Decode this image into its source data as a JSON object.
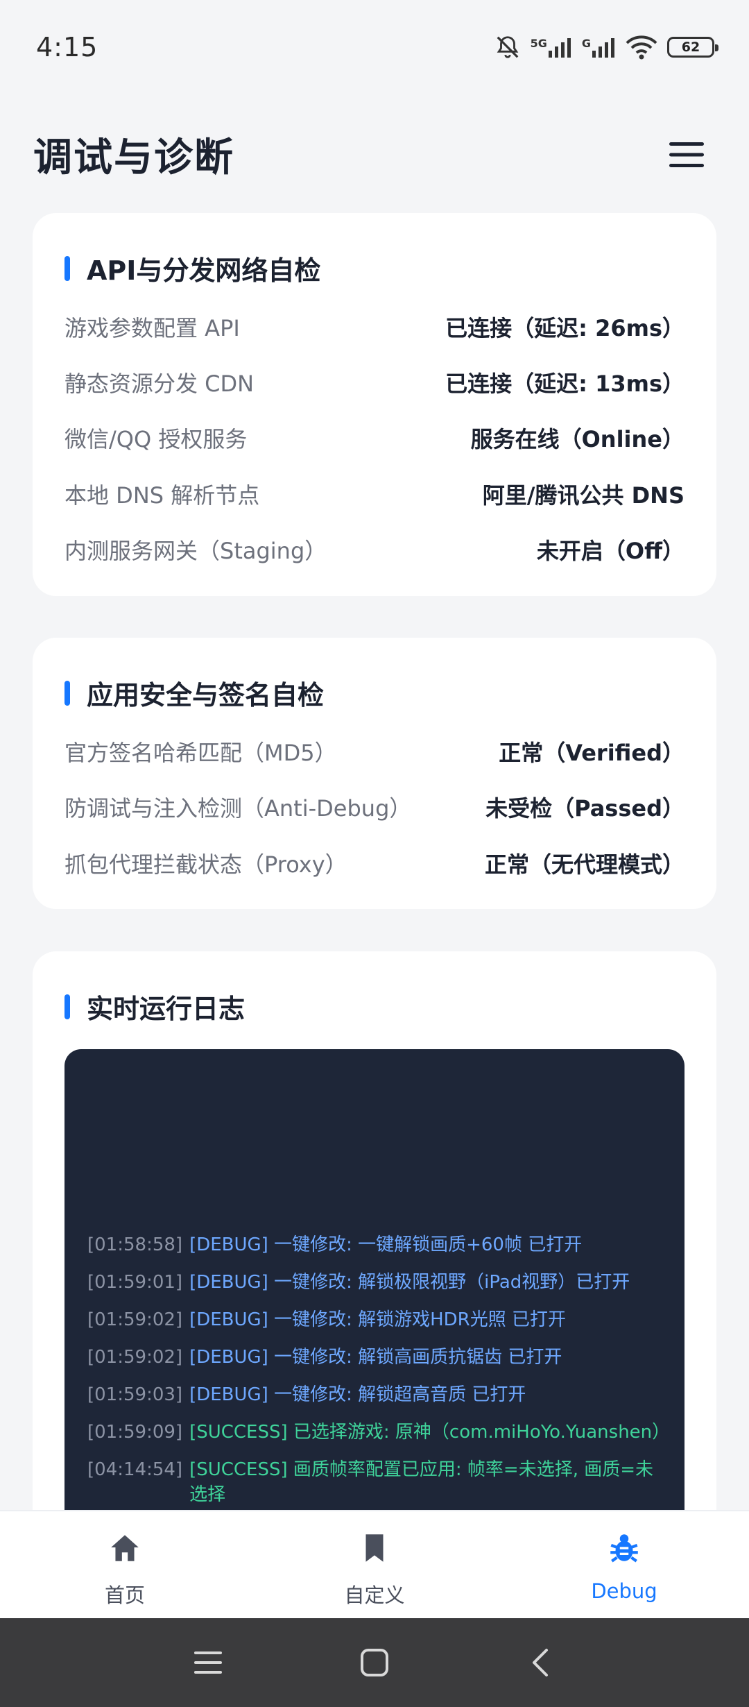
{
  "status_bar": {
    "time": "4:15",
    "network_1": "5G",
    "network_2": "G",
    "battery": "62"
  },
  "header": {
    "title": "调试与诊断",
    "menu_icon": "hamburger-menu-icon"
  },
  "network_card": {
    "title": "API与分发网络自检",
    "rows": [
      {
        "key": "游戏参数配置 API",
        "value": "已连接（延迟: 26ms）"
      },
      {
        "key": "静态资源分发 CDN",
        "value": "已连接（延迟: 13ms）"
      },
      {
        "key": "微信/QQ 授权服务",
        "value": "服务在线（Online）"
      },
      {
        "key": "本地 DNS 解析节点",
        "value": "阿里/腾讯公共 DNS"
      },
      {
        "key": "内测服务网关（Staging）",
        "value": "未开启（Off）"
      }
    ]
  },
  "security_card": {
    "title": "应用安全与签名自检",
    "rows": [
      {
        "key": "官方签名哈希匹配（MD5）",
        "value": "正常（Verified）"
      },
      {
        "key": "防调试与注入检测（Anti-Debug）",
        "value": "未受检（Passed）"
      },
      {
        "key": "抓包代理拦截状态（Proxy）",
        "value": "正常（无代理模式）"
      }
    ]
  },
  "log_card": {
    "title": "实时运行日志",
    "lines": [
      {
        "ts": "[01:58:58]",
        "msg": "[DEBUG] 一键修改: 一键解锁画质+60帧 已打开",
        "level": "debug"
      },
      {
        "ts": "[01:59:01]",
        "msg": "[DEBUG] 一键修改: 解锁极限视野（iPad视野）已打开",
        "level": "debug"
      },
      {
        "ts": "[01:59:02]",
        "msg": "[DEBUG] 一键修改: 解锁游戏HDR光照 已打开",
        "level": "debug"
      },
      {
        "ts": "[01:59:02]",
        "msg": "[DEBUG] 一键修改: 解锁高画质抗锯齿 已打开",
        "level": "debug"
      },
      {
        "ts": "[01:59:03]",
        "msg": "[DEBUG] 一键修改: 解锁超高音质 已打开",
        "level": "debug"
      },
      {
        "ts": "[01:59:09]",
        "msg": "[SUCCESS] 已选择游戏: 原神（com.miHoYo.Yuanshen）",
        "level": "success"
      },
      {
        "ts": "[04:14:54]",
        "msg": "[SUCCESS] 画质帧率配置已应用: 帧率=未选择, 画质=未选择",
        "level": "success"
      }
    ]
  },
  "bottom_nav": {
    "items": [
      {
        "label": "首页",
        "icon": "home-icon"
      },
      {
        "label": "自定义",
        "icon": "bookmark-icon"
      },
      {
        "label": "Debug",
        "icon": "bug-icon"
      }
    ],
    "active_color": "#1677ff",
    "inactive_color": "#4a4f5c"
  },
  "colors": {
    "accent": "#1677ff",
    "console_bg": "#1e2638",
    "debug_text": "#6ea8ff",
    "success_text": "#3fd39a"
  }
}
